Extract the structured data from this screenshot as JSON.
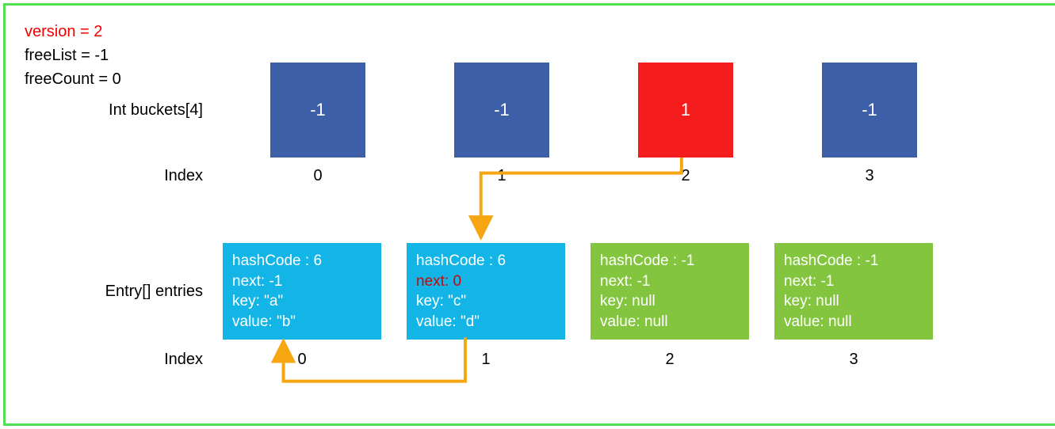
{
  "meta": {
    "version_label": "version = 2",
    "freeList_label": "freeList = -1",
    "freeCount_label": "freeCount = 0"
  },
  "labels": {
    "buckets": "Int buckets[4]",
    "index": "Index",
    "entries": "Entry[] entries"
  },
  "buckets": [
    {
      "value": "-1",
      "color": "blue"
    },
    {
      "value": "-1",
      "color": "blue"
    },
    {
      "value": "1",
      "color": "red"
    },
    {
      "value": "-1",
      "color": "blue"
    }
  ],
  "bucket_indices": [
    "0",
    "1",
    "2",
    "3"
  ],
  "entries": [
    {
      "hashCode": "hashCode : 6",
      "next": "next: -1",
      "key": "key: \"a\"",
      "value": "value: \"b\"",
      "color": "cyan",
      "next_hl": false
    },
    {
      "hashCode": "hashCode : 6",
      "next": "next: 0",
      "key": "key: \"c\"",
      "value": "value: \"d\"",
      "color": "cyan",
      "next_hl": true
    },
    {
      "hashCode": "hashCode : -1",
      "next": "next: -1",
      "key": "key: null",
      "value": "value: null",
      "color": "green",
      "next_hl": false
    },
    {
      "hashCode": "hashCode : -1",
      "next": "next: -1",
      "key": "key: null",
      "value": "value: null",
      "color": "green",
      "next_hl": false
    }
  ],
  "entry_indices": [
    "0",
    "1",
    "2",
    "3"
  ],
  "chart_data": {
    "type": "table",
    "title": "Dictionary internal state",
    "version": 2,
    "freeList": -1,
    "freeCount": 0,
    "buckets": [
      -1,
      -1,
      1,
      -1
    ],
    "entries": [
      {
        "index": 0,
        "hashCode": 6,
        "next": -1,
        "key": "a",
        "value": "b"
      },
      {
        "index": 1,
        "hashCode": 6,
        "next": 0,
        "key": "c",
        "value": "d"
      },
      {
        "index": 2,
        "hashCode": -1,
        "next": -1,
        "key": null,
        "value": null
      },
      {
        "index": 3,
        "hashCode": -1,
        "next": -1,
        "key": null,
        "value": null
      }
    ],
    "arrows": [
      {
        "from": "bucket[2]",
        "to": "entry[1]"
      },
      {
        "from": "entry[1]",
        "to": "entry[0]"
      }
    ]
  }
}
